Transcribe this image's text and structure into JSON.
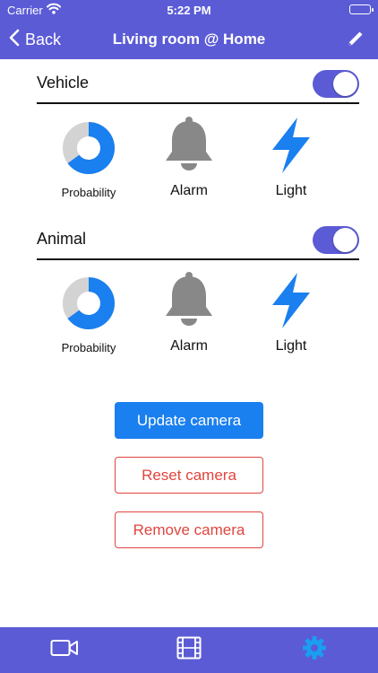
{
  "status_bar": {
    "carrier": "Carrier",
    "time": "5:22 PM"
  },
  "nav": {
    "back_label": "Back",
    "title": "Living room @ Home"
  },
  "sections": [
    {
      "label": "Vehicle",
      "enabled": true,
      "features": [
        {
          "label": "Probability",
          "icon": "probability-ring-icon"
        },
        {
          "label": "Alarm",
          "icon": "bell-icon"
        },
        {
          "label": "Light",
          "icon": "lightning-icon"
        }
      ]
    },
    {
      "label": "Animal",
      "enabled": true,
      "features": [
        {
          "label": "Probability",
          "icon": "probability-ring-icon"
        },
        {
          "label": "Alarm",
          "icon": "bell-icon"
        },
        {
          "label": "Light",
          "icon": "lightning-icon"
        }
      ]
    }
  ],
  "buttons": {
    "update": "Update camera",
    "reset": "Reset camera",
    "remove": "Remove camera"
  },
  "tabs": [
    {
      "icon": "video-camera-icon",
      "active": false
    },
    {
      "icon": "film-icon",
      "active": false
    },
    {
      "icon": "gear-icon",
      "active": true
    }
  ],
  "colors": {
    "accent": "#5b5bd6",
    "primary_button": "#1a7fef",
    "danger": "#e0453e",
    "icon_gray": "#888888",
    "icon_blue": "#1a7fef",
    "tab_active": "#1a9ef0"
  }
}
